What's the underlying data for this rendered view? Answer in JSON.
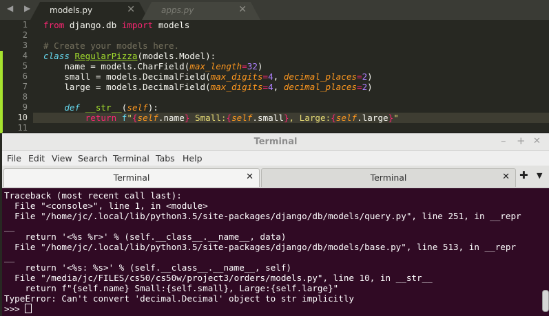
{
  "editor": {
    "tabs": [
      {
        "label": "models.py",
        "close": "✕"
      },
      {
        "label": "apps.py",
        "close": "✕"
      }
    ],
    "nav_arrows": "◀ ▶",
    "line_numbers": [
      "1",
      "2",
      "3",
      "4",
      "5",
      "6",
      "7",
      "8",
      "9",
      "10",
      "11"
    ],
    "current_line": "10",
    "lines": [
      "from django.db import models",
      "",
      "# Create your models here.",
      "class RegularPizza(models.Model):",
      "    name = models.CharField(max_length=32)",
      "    small = models.DecimalField(max_digits=4, decimal_places=2)",
      "    large = models.DecimalField(max_digits=4, decimal_places=2)",
      "",
      "    def __str__(self):",
      "        return f\"{self.name} Small:{self.small}, Large:{self.large}\"",
      ""
    ]
  },
  "terminal": {
    "title": "Terminal",
    "window_buttons": {
      "minimize": "–",
      "maximize": "+",
      "close": "✕"
    },
    "menu": [
      "File",
      "Edit",
      "View",
      "Search",
      "Terminal",
      "Tabs",
      "Help"
    ],
    "tabs": [
      {
        "label": "Terminal",
        "close": "✕"
      },
      {
        "label": "Terminal",
        "close": "✕"
      }
    ],
    "new_tab": "✚",
    "tab_menu": "▼",
    "output": [
      "Traceback (most recent call last):",
      "  File \"<console>\", line 1, in <module>",
      "  File \"/home/jc/.local/lib/python3.5/site-packages/django/db/models/query.py\", line 251, in __repr",
      "__",
      "    return '<%s %r>' % (self.__class__.__name__, data)",
      "  File \"/home/jc/.local/lib/python3.5/site-packages/django/db/models/base.py\", line 513, in __repr",
      "__",
      "    return '<%s: %s>' % (self.__class__.__name__, self)",
      "  File \"/media/jc/FILES/cs50/cs50w/project3/orders/models.py\", line 10, in __str__",
      "    return f\"{self.name} Small:{self.small}, Large:{self.large}\"",
      "TypeError: Can't convert 'decimal.Decimal' object to str implicitly"
    ],
    "prompt": ">>> "
  }
}
